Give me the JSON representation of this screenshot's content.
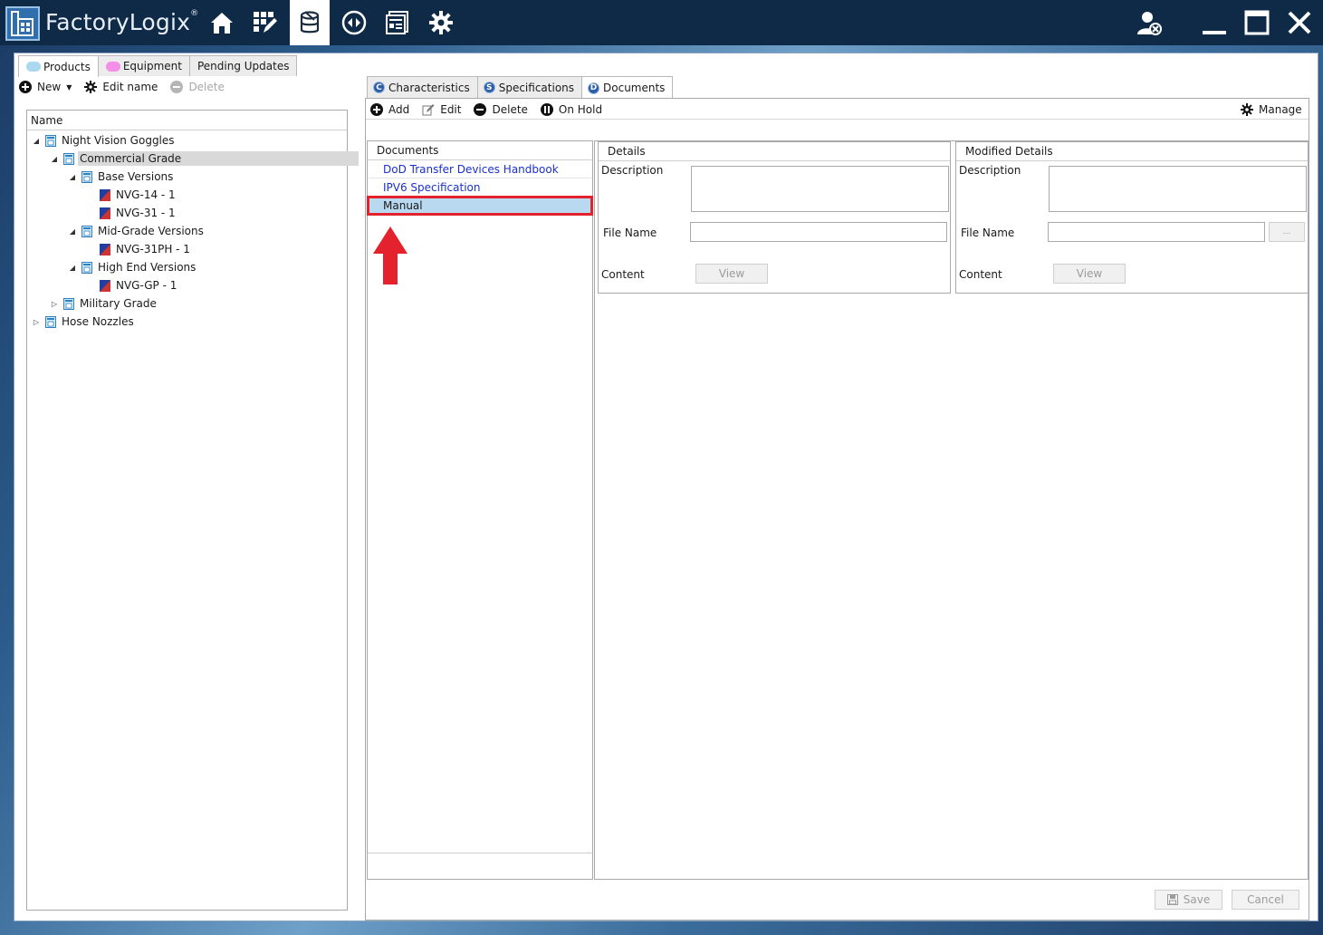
{
  "app": {
    "title": "FactoryLogix",
    "trademark": "®"
  },
  "colors": {
    "accent": "#2f6fad",
    "link": "#1a2fd0",
    "selection": "#b9d9f0",
    "highlight": "#e4222d"
  },
  "nav": [
    {
      "name": "home-icon"
    },
    {
      "name": "grid-edit-icon"
    },
    {
      "name": "product-database-icon",
      "active": true
    },
    {
      "name": "routing-icon"
    },
    {
      "name": "documents-window-icon"
    },
    {
      "name": "gear-icon"
    }
  ],
  "outer_tabs": [
    {
      "label": "Products",
      "color": "#a9d8ef",
      "active": true
    },
    {
      "label": "Equipment",
      "color": "#f48fe8"
    },
    {
      "label": "Pending Updates"
    }
  ],
  "left_toolbar": {
    "new": "New",
    "edit_name": "Edit name",
    "delete": "Delete"
  },
  "tree": {
    "header": "Name",
    "nodes": [
      {
        "label": "Night Vision Goggles",
        "level": 0,
        "expanded": true,
        "kind": "group"
      },
      {
        "label": "Commercial Grade",
        "level": 1,
        "expanded": true,
        "kind": "group",
        "selected": true
      },
      {
        "label": "Base Versions",
        "level": 2,
        "expanded": true,
        "kind": "group"
      },
      {
        "label": "NVG-14 - 1",
        "level": 3,
        "kind": "product"
      },
      {
        "label": "NVG-31 - 1",
        "level": 3,
        "kind": "product"
      },
      {
        "label": "Mid-Grade Versions",
        "level": 2,
        "expanded": true,
        "kind": "group"
      },
      {
        "label": "NVG-31PH - 1",
        "level": 3,
        "kind": "product"
      },
      {
        "label": "High End Versions",
        "level": 2,
        "expanded": true,
        "kind": "group"
      },
      {
        "label": "NVG-GP - 1",
        "level": 3,
        "kind": "product"
      },
      {
        "label": "Military Grade",
        "level": 1,
        "expanded": false,
        "kind": "group"
      },
      {
        "label": "Hose Nozzles",
        "level": 0,
        "expanded": false,
        "kind": "group"
      }
    ]
  },
  "inner_tabs": [
    {
      "letter": "C",
      "label": "Characteristics"
    },
    {
      "letter": "S",
      "label": "Specifications"
    },
    {
      "letter": "D",
      "label": "Documents",
      "active": true
    }
  ],
  "doc_toolbar": {
    "add": "Add",
    "edit": "Edit",
    "delete": "Delete",
    "on_hold": "On Hold",
    "manage": "Manage"
  },
  "documents": {
    "header": "Documents",
    "items": [
      {
        "label": "DoD Transfer Devices Handbook"
      },
      {
        "label": "IPV6 Specification"
      },
      {
        "label": "Manual",
        "selected": true
      }
    ]
  },
  "details": {
    "header": "Details",
    "description_label": "Description",
    "description_value": "",
    "file_name_label": "File Name",
    "file_name_value": "",
    "content_label": "Content",
    "view_label": "View"
  },
  "modified_details": {
    "header": "Modified Details",
    "description_label": "Description",
    "description_value": "",
    "file_name_label": "File Name",
    "file_name_value": "",
    "browse_label": "...",
    "content_label": "Content",
    "view_label": "View"
  },
  "footer": {
    "save": "Save",
    "cancel": "Cancel"
  }
}
